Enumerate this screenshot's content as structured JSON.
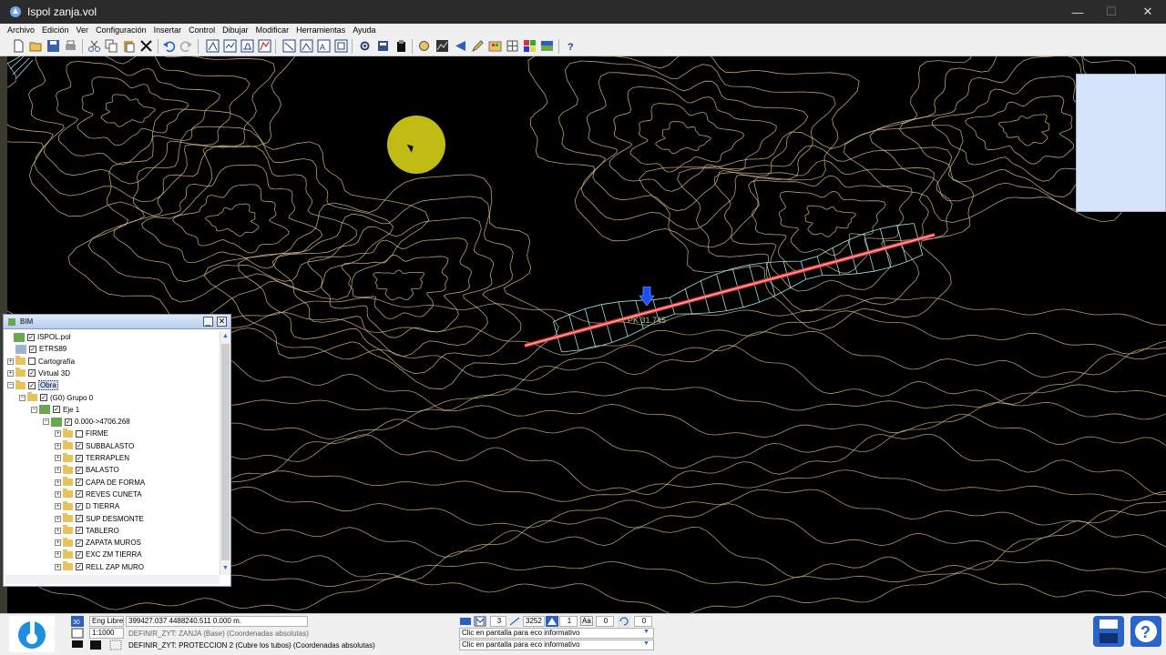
{
  "window": {
    "app_name": "Ispol",
    "document": "zanja.vol",
    "minimize": "—",
    "maximize": "☐",
    "close": "✕"
  },
  "menu": [
    "Archivo",
    "Edición",
    "Ver",
    "Configuración",
    "Insertar",
    "Control",
    "Dibujar",
    "Modificar",
    "Herramientas",
    "Ayuda"
  ],
  "toolbar_icons": [
    "new-icon",
    "open-icon",
    "save-icon",
    "print-icon",
    "cut-icon",
    "copy-icon",
    "paste-icon",
    "delete-icon",
    "undo-icon",
    "redo-icon",
    "view-plan-icon",
    "view-profile-icon",
    "view-section-icon",
    "view-3d-icon",
    "layer-icon",
    "layer-alt-icon",
    "text-icon",
    "zoom-window-icon",
    "settings-icon",
    "points-icon",
    "tools-icon",
    "chart-icon",
    "arrow-icon",
    "pencil-icon",
    "palette-icon",
    "grid-icon",
    "colors-icon",
    "landscape-icon",
    "help-icon"
  ],
  "canvas": {
    "pk_label": "PK 31.745",
    "colors": {
      "contour": "#d9b98a",
      "axis": "#f23a3a",
      "section_lines": "#9fe3e0",
      "marker": "#1a4dff"
    }
  },
  "bim": {
    "title": "BIM",
    "minimize": "_",
    "close": "✕",
    "nodes": [
      {
        "label": "ISPOL.pol",
        "level": 0,
        "icon": "bim-root-icon",
        "expander": "",
        "checked": true
      },
      {
        "label": "ETRS89",
        "level": 1,
        "icon": "globe-icon",
        "expander": "",
        "checked": true
      },
      {
        "label": "Cartografía",
        "level": 1,
        "icon": "folder-icon",
        "expander": "+",
        "checked": false
      },
      {
        "label": "Virtual 3D",
        "level": 1,
        "icon": "folder-icon",
        "expander": "+",
        "checked": true
      },
      {
        "label": "Obra",
        "level": 1,
        "icon": "folder-icon",
        "expander": "−",
        "checked": true,
        "selected": true
      },
      {
        "label": "(G0) Grupo 0",
        "level": 2,
        "icon": "folder-icon",
        "expander": "−",
        "checked": true
      },
      {
        "label": "Eje 1",
        "level": 3,
        "icon": "axis-icon",
        "expander": "−",
        "checked": true
      },
      {
        "label": "0.000->4706.268",
        "level": 4,
        "icon": "axis-icon",
        "expander": "−",
        "checked": true
      },
      {
        "label": "FIRME",
        "level": 5,
        "icon": "folder-icon",
        "expander": "+",
        "checked": false
      },
      {
        "label": "SUBBALASTO",
        "level": 5,
        "icon": "folder-icon",
        "expander": "+",
        "checked": true
      },
      {
        "label": "TERRAPLEN",
        "level": 5,
        "icon": "folder-icon",
        "expander": "+",
        "checked": true
      },
      {
        "label": "BALASTO",
        "level": 5,
        "icon": "folder-icon",
        "expander": "+",
        "checked": true
      },
      {
        "label": "CAPA DE FORMA",
        "level": 5,
        "icon": "folder-icon",
        "expander": "+",
        "checked": true
      },
      {
        "label": "REVES CUNETA",
        "level": 5,
        "icon": "folder-icon",
        "expander": "+",
        "checked": true
      },
      {
        "label": "D TIERRA",
        "level": 5,
        "icon": "folder-icon",
        "expander": "+",
        "checked": true
      },
      {
        "label": "SUP DESMONTE",
        "level": 5,
        "icon": "folder-icon",
        "expander": "+",
        "checked": true
      },
      {
        "label": "TABLERO",
        "level": 5,
        "icon": "folder-icon",
        "expander": "+",
        "checked": true
      },
      {
        "label": "ZAPATA MUROS",
        "level": 5,
        "icon": "folder-icon",
        "expander": "+",
        "checked": true
      },
      {
        "label": "EXC ZM TIERRA",
        "level": 5,
        "icon": "folder-icon",
        "expander": "+",
        "checked": true
      },
      {
        "label": "RELL ZAP MURO",
        "level": 5,
        "icon": "folder-icon",
        "expander": "+",
        "checked": true
      }
    ]
  },
  "status": {
    "mode": "Eng Libre",
    "scale": "1:1000",
    "coord_x": "399427.037",
    "coord_y": "4488240.511",
    "coord_z": "0.000",
    "unit": "m.",
    "cmd_line1": "DEFINIR_ZYT: ZANJA (Base) (Coordenadas absolutas)",
    "cmd_line2": "DEFINIR_ZYT: PROTECCION 2 (Cubre los tubos) (Coordenadas absolutas)",
    "hint1": "Clic en pantalla para eco informativo",
    "hint2": "Clic en pantalla para eco informativo",
    "field_a": "3",
    "field_b": "3252",
    "field_c": "1",
    "field_d": "0",
    "field_e": "0",
    "label_aa": "Aa"
  }
}
